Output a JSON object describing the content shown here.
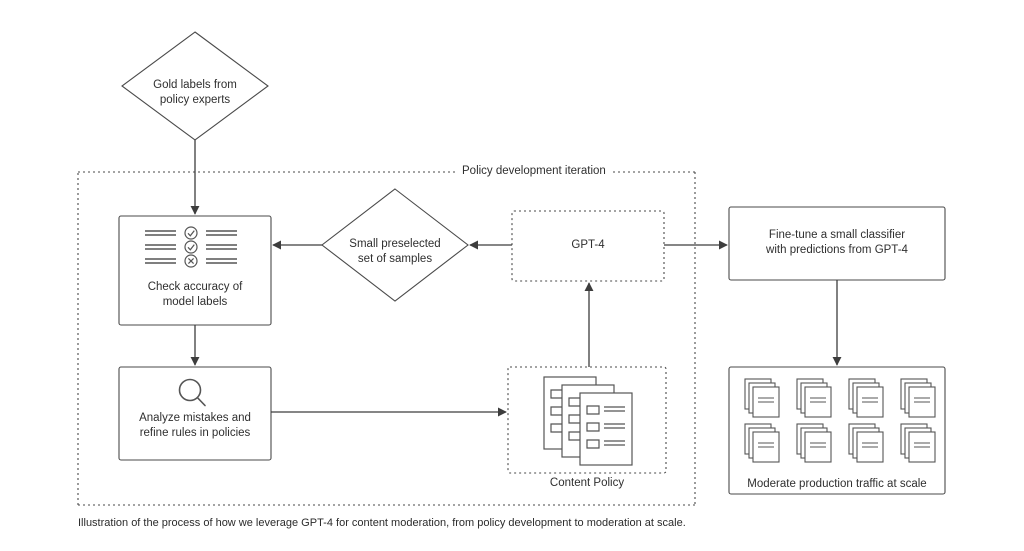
{
  "figure": {
    "caption": "Illustration of the process of how we leverage GPT-4 for content moderation, from policy development to moderation at scale.",
    "stroke_color": "#4a4a4a",
    "text_color": "#2f2f2f",
    "background": "#ffffff"
  },
  "group": {
    "title": "Policy development iteration",
    "border_style": "dotted"
  },
  "nodes": {
    "gold_labels": {
      "shape": "diamond",
      "label": "Gold labels from\npolicy experts"
    },
    "check_accuracy": {
      "shape": "rect",
      "label": "Check accuracy of\nmodel labels",
      "icon": "checklist-icon",
      "icon_rows": [
        "check",
        "check",
        "cross"
      ]
    },
    "small_preselected": {
      "shape": "diamond",
      "label": "Small preselected\nset of samples"
    },
    "gpt4": {
      "shape": "rect-dotted",
      "label": "GPT-4"
    },
    "fine_tune": {
      "shape": "rect",
      "label": "Fine-tune a small classifier\nwith predictions from GPT-4"
    },
    "analyze_mistakes": {
      "shape": "rect",
      "label": "Analyze mistakes and\nrefine rules in policies",
      "icon": "magnifier-icon"
    },
    "content_policy": {
      "shape": "rect-dotted",
      "label": "Content Policy",
      "icon": "stacked-documents-icon",
      "document_rows": 3
    },
    "moderate_scale": {
      "shape": "rect",
      "label": "Moderate production traffic at scale",
      "icon": "document-stack-grid-icon",
      "icon_columns": 4,
      "icon_rows": 2,
      "icon_count": 8
    }
  },
  "edges": [
    {
      "from": "gold_labels",
      "to": "check_accuracy",
      "direction": "down"
    },
    {
      "from": "small_preselected",
      "to": "check_accuracy",
      "direction": "left"
    },
    {
      "from": "gpt4",
      "to": "small_preselected",
      "direction": "left"
    },
    {
      "from": "gpt4",
      "to": "fine_tune",
      "direction": "right"
    },
    {
      "from": "check_accuracy",
      "to": "analyze_mistakes",
      "direction": "down"
    },
    {
      "from": "analyze_mistakes",
      "to": "content_policy",
      "direction": "right"
    },
    {
      "from": "content_policy",
      "to": "gpt4",
      "direction": "up"
    },
    {
      "from": "fine_tune",
      "to": "moderate_scale",
      "direction": "down"
    }
  ]
}
